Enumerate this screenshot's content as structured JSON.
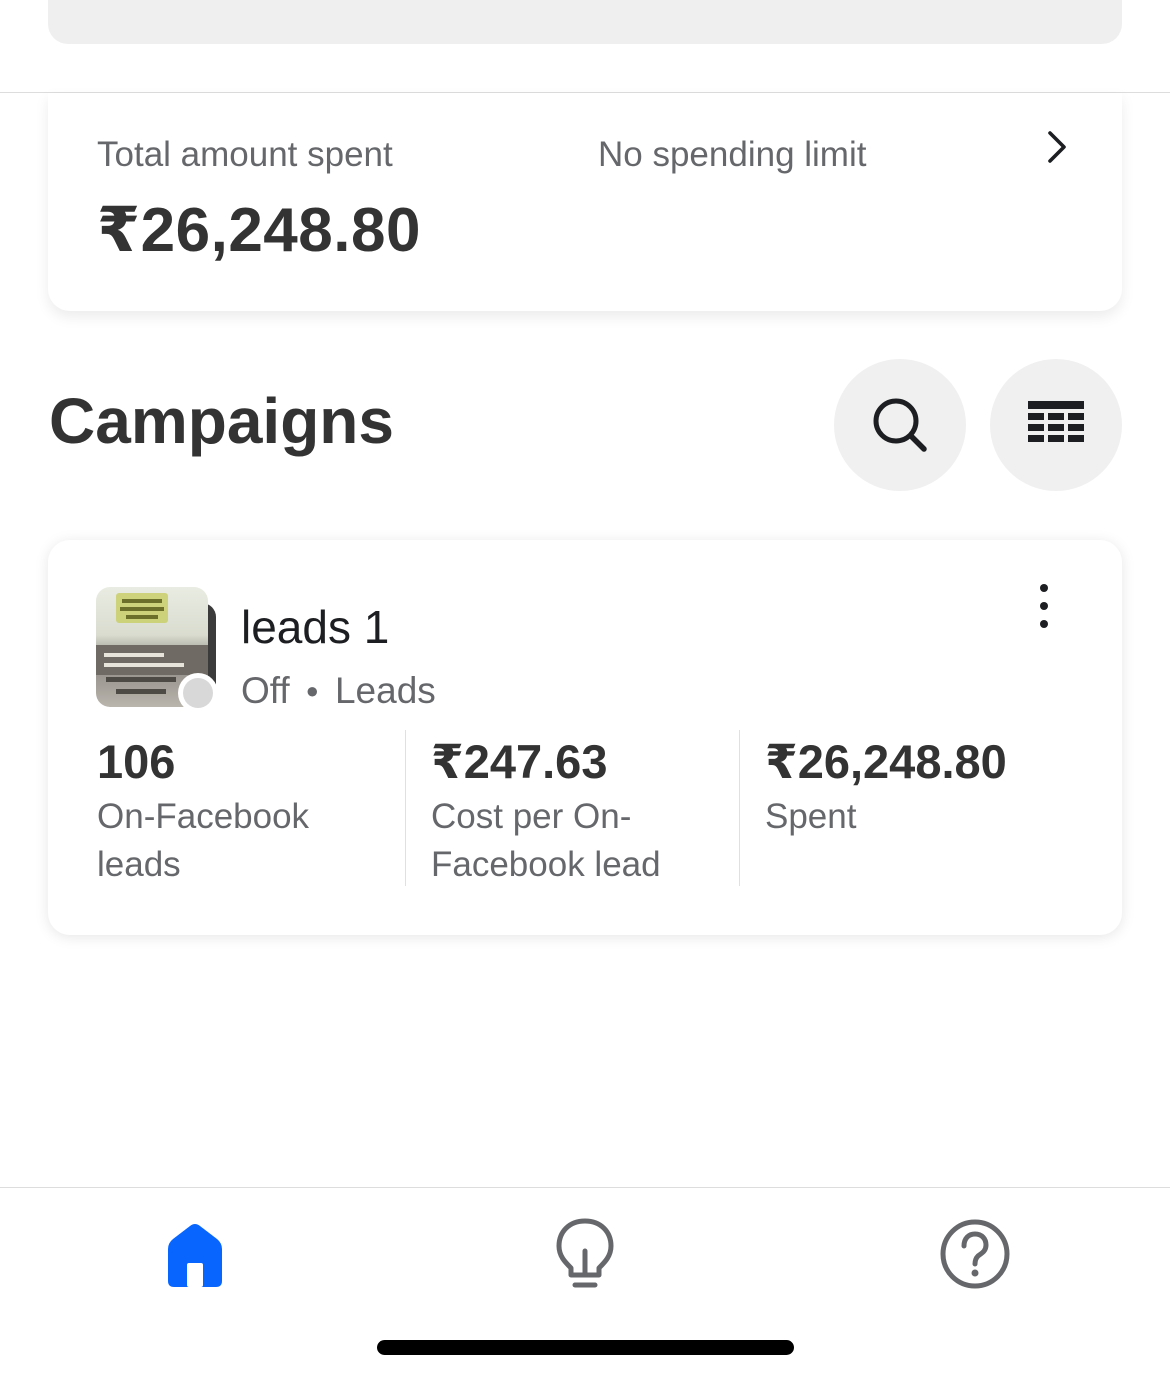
{
  "spend_card": {
    "total_label": "Total amount spent",
    "total_value": "₹26,248.80",
    "limit_label": "No spending limit"
  },
  "campaigns": {
    "title": "Campaigns",
    "search_icon": "search-icon",
    "table_icon": "table-icon"
  },
  "campaign": {
    "name": "leads 1",
    "status": "Off",
    "objective": "Leads",
    "status_color": "#d8d8d8",
    "metrics": [
      {
        "value": "106",
        "label": "On-Facebook leads"
      },
      {
        "value": "₹247.63",
        "label": "Cost per On-Facebook lead"
      },
      {
        "value": "₹26,248.80",
        "label": "Spent"
      }
    ]
  },
  "bottom_nav": {
    "items": [
      {
        "icon": "home-icon",
        "active": true
      },
      {
        "icon": "lightbulb-icon",
        "active": false
      },
      {
        "icon": "help-icon",
        "active": false
      }
    ],
    "active_color": "#0866ff",
    "inactive_color": "#65676b"
  }
}
